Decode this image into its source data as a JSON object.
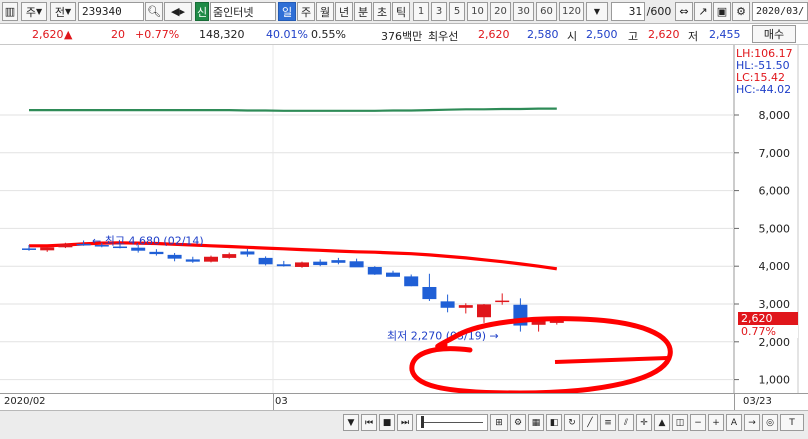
{
  "toolbar": {
    "mode": "주",
    "type": "전",
    "code": "239340",
    "badge": "신",
    "name": "줌인터넷",
    "periods": [
      "일",
      "주",
      "월",
      "년",
      "분",
      "초",
      "틱"
    ],
    "intervals": [
      "1",
      "3",
      "5",
      "10",
      "20",
      "30",
      "60",
      "120"
    ],
    "count": "31",
    "total": "/600",
    "date": "2020/03/"
  },
  "quote": {
    "price": "2,620",
    "arrow": "▲",
    "change": "20",
    "change_pct": "+0.77%",
    "volume": "148,320",
    "ratio": "40.01%",
    "turnover": "0.55%",
    "amount": "376백만",
    "best_label": "최우선",
    "best_ask": "2,620",
    "best_bid": "2,580",
    "open_label": "시",
    "open": "2,500",
    "high_label": "고",
    "high": "2,620",
    "low_label": "저",
    "low": "2,455"
  },
  "indicators": {
    "lh": "LH:106.17",
    "hl": "HL:-51.50",
    "lc": "LC:15.42",
    "hc": "HC:-44.02",
    "buy_button": "매수"
  },
  "axis": {
    "y_ticks": [
      "8,000",
      "7,000",
      "6,000",
      "5,000",
      "4,000",
      "3,000",
      "2,000",
      "1,000"
    ],
    "x_start": "2020/02",
    "x_mid": "03",
    "x_end": "03/23"
  },
  "price_tag": {
    "price": "2,620",
    "pct": "0.77%"
  },
  "annotations": {
    "high": "최고 4,680 (02/14)",
    "low": "최저 2,270 (03/19)"
  },
  "colors": {
    "up": "#e0161b",
    "down": "#1f5fd6",
    "ma_green": "#2e8b57",
    "ma_red": "#ff0000"
  },
  "chart_data": {
    "type": "candlestick",
    "ylim": [
      600,
      8600
    ],
    "y_ticks": [
      8000,
      7000,
      6000,
      5000,
      4000,
      3000,
      2000,
      1000
    ],
    "x_tick_labels": [
      "2020/02",
      "03",
      "03/23"
    ],
    "candles": [
      {
        "o": 4470,
        "h": 4560,
        "l": 4410,
        "c": 4430
      },
      {
        "o": 4420,
        "h": 4500,
        "l": 4380,
        "c": 4500
      },
      {
        "o": 4500,
        "h": 4620,
        "l": 4480,
        "c": 4580
      },
      {
        "o": 4590,
        "h": 4680,
        "l": 4540,
        "c": 4570
      },
      {
        "o": 4560,
        "h": 4620,
        "l": 4500,
        "c": 4530
      },
      {
        "o": 4520,
        "h": 4580,
        "l": 4470,
        "c": 4500
      },
      {
        "o": 4490,
        "h": 4560,
        "l": 4360,
        "c": 4410
      },
      {
        "o": 4380,
        "h": 4450,
        "l": 4280,
        "c": 4320
      },
      {
        "o": 4300,
        "h": 4350,
        "l": 4130,
        "c": 4200
      },
      {
        "o": 4180,
        "h": 4250,
        "l": 4090,
        "c": 4120
      },
      {
        "o": 4120,
        "h": 4280,
        "l": 4100,
        "c": 4250
      },
      {
        "o": 4220,
        "h": 4360,
        "l": 4200,
        "c": 4320
      },
      {
        "o": 4390,
        "h": 4460,
        "l": 4250,
        "c": 4310
      },
      {
        "o": 4220,
        "h": 4260,
        "l": 4020,
        "c": 4050
      },
      {
        "o": 4050,
        "h": 4140,
        "l": 3990,
        "c": 4000
      },
      {
        "o": 3980,
        "h": 4120,
        "l": 3960,
        "c": 4100
      },
      {
        "o": 4120,
        "h": 4180,
        "l": 4000,
        "c": 4030
      },
      {
        "o": 4160,
        "h": 4220,
        "l": 4050,
        "c": 4090
      },
      {
        "o": 4130,
        "h": 4200,
        "l": 3980,
        "c": 3970
      },
      {
        "o": 3980,
        "h": 4000,
        "l": 3770,
        "c": 3780
      },
      {
        "o": 3830,
        "h": 3880,
        "l": 3740,
        "c": 3720
      },
      {
        "o": 3730,
        "h": 3780,
        "l": 3470,
        "c": 3470
      },
      {
        "o": 3450,
        "h": 3800,
        "l": 3080,
        "c": 3130
      },
      {
        "o": 3070,
        "h": 3250,
        "l": 2780,
        "c": 2900
      },
      {
        "o": 2900,
        "h": 3020,
        "l": 2750,
        "c": 2970
      },
      {
        "o": 2650,
        "h": 3000,
        "l": 2500,
        "c": 2990
      },
      {
        "o": 3060,
        "h": 3280,
        "l": 2980,
        "c": 3090
      },
      {
        "o": 2980,
        "h": 3150,
        "l": 2270,
        "c": 2430
      },
      {
        "o": 2450,
        "h": 2640,
        "l": 2270,
        "c": 2620
      },
      {
        "o": 2500,
        "h": 2620,
        "l": 2455,
        "c": 2620
      }
    ],
    "ma_long": [
      8130,
      8130,
      8130,
      8130,
      8130,
      8130,
      8130,
      8130,
      8130,
      8130,
      8130,
      8130,
      8120,
      8120,
      8110,
      8110,
      8110,
      8110,
      8110,
      8110,
      8120,
      8120,
      8130,
      8140,
      8150,
      8150,
      8160,
      8160,
      8170,
      8170
    ],
    "ma_mid": [
      4540,
      4540,
      4560,
      4590,
      4610,
      4620,
      4610,
      4600,
      4580,
      4560,
      4540,
      4520,
      4500,
      4480,
      4460,
      4440,
      4420,
      4400,
      4380,
      4370,
      4350,
      4330,
      4300,
      4260,
      4220,
      4170,
      4120,
      4060,
      4000,
      3930
    ]
  }
}
